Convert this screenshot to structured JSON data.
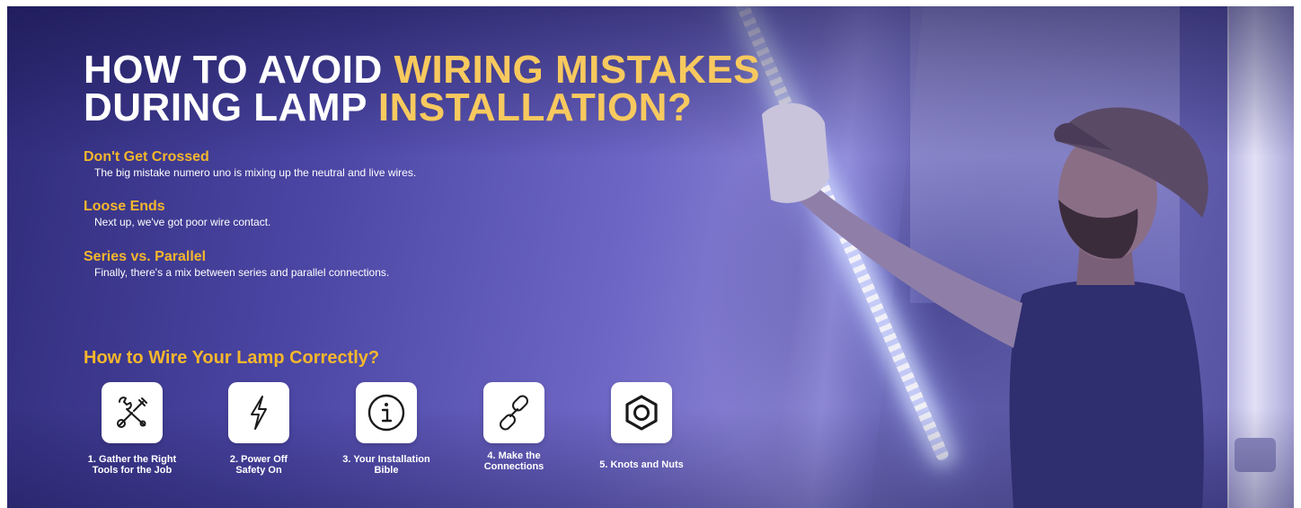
{
  "banner": {
    "headline_line1_white": "HOW TO AVOID ",
    "headline_line1_yellow": "WIRING MISTAKES",
    "headline_line2_white": "DURING LAMP ",
    "headline_line2_yellow": "INSTALLATION?"
  },
  "tips": [
    {
      "title": "Don't Get Crossed",
      "desc": "The big mistake numero uno is mixing up the neutral and live wires."
    },
    {
      "title": "Loose Ends",
      "desc": "Next up, we've got poor wire contact."
    },
    {
      "title": "Series vs. Parallel",
      "desc": "Finally, there's a mix between series and parallel connections."
    }
  ],
  "steps_section": {
    "title": "How to Wire Your Lamp Correctly?",
    "steps": [
      {
        "label_line1": "1. Gather the Right",
        "label_line2": "Tools for the Job",
        "icon": "tools-icon"
      },
      {
        "label_line1": "2. Power Off",
        "label_line2": "Safety On",
        "icon": "lightning-icon"
      },
      {
        "label_line1": "3. Your Installation",
        "label_line2": "Bible",
        "icon": "info-icon"
      },
      {
        "label_line1": "4. Make the",
        "label_line2": "Connections",
        "icon": "link-icon"
      },
      {
        "label_line1": "5. Knots and Nuts",
        "label_line2": "",
        "icon": "hex-nut-icon"
      }
    ]
  },
  "colors": {
    "accent_yellow": "#f5b72c",
    "headline_yellow": "#f7c95e",
    "background_purple": "#4b46a4"
  }
}
